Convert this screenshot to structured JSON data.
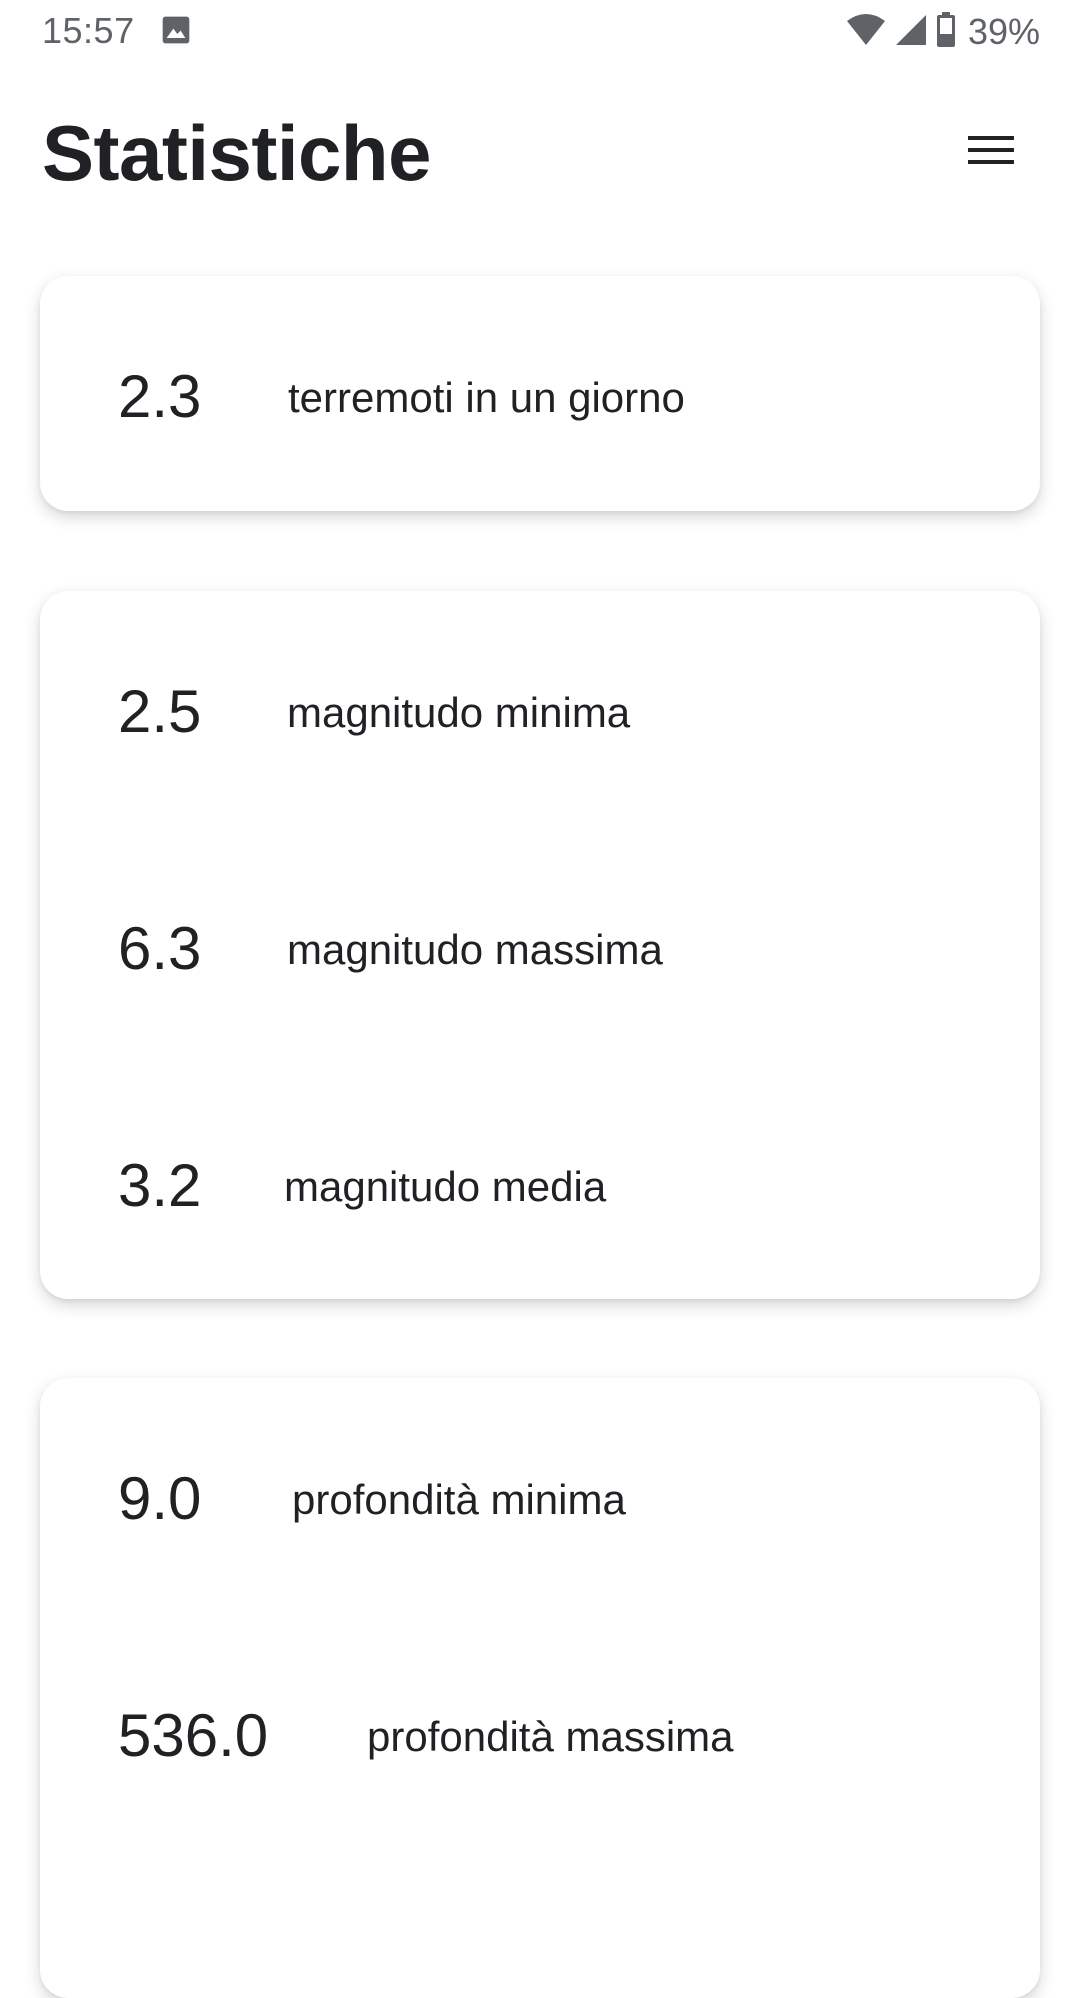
{
  "status_bar": {
    "time": "15:57",
    "battery": "39%",
    "icons": [
      "photo-icon",
      "wifi-icon",
      "cell-signal-icon",
      "battery-icon"
    ]
  },
  "header": {
    "title": "Statistiche",
    "menu_icon": "hamburger-menu-icon"
  },
  "cards": {
    "daily": {
      "rows": [
        {
          "value": "2.3",
          "label": "terremoti in un giorno"
        }
      ]
    },
    "magnitude": {
      "rows": [
        {
          "value": "2.5",
          "label": "magnitudo minima"
        },
        {
          "value": "6.3",
          "label": "magnitudo massima"
        },
        {
          "value": "3.2",
          "label": "magnitudo media"
        }
      ]
    },
    "depth": {
      "rows": [
        {
          "value": "9.0",
          "label": "profondità minima"
        },
        {
          "value": "536.0",
          "label": "profondità massima"
        }
      ]
    }
  },
  "colors": {
    "text": "#202124",
    "status_text": "#5f6368",
    "background": "#ffffff"
  }
}
